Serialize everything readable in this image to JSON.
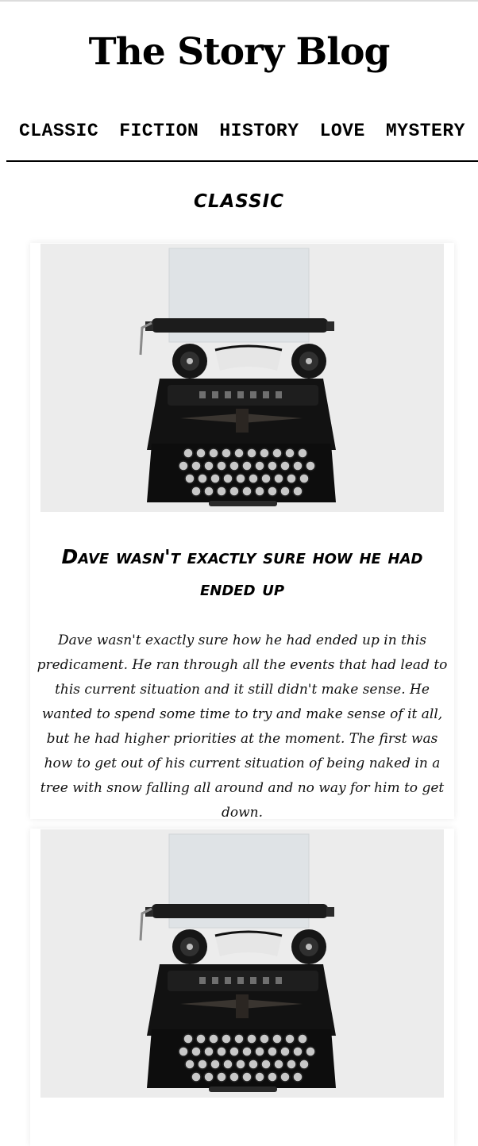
{
  "site": {
    "title": "The Story Blog"
  },
  "nav": {
    "items": [
      {
        "label": "CLASSIC"
      },
      {
        "label": "FICTION"
      },
      {
        "label": "HISTORY"
      },
      {
        "label": "LOVE"
      },
      {
        "label": "MYSTERY"
      }
    ]
  },
  "section": {
    "title": "CLASSIC"
  },
  "posts": [
    {
      "image_icon": "typewriter-photo",
      "title": "Dave wasn't exactly sure how he had ended up",
      "body": "Dave wasn't exactly sure how he had ended up in this predicament. He ran through all the events that had lead to this current situation and it still didn't make sense. He wanted to spend some time to try and make sense of it all, but he had higher priorities at the moment. The first was how to get out of his current situation of being naked in a tree with snow falling all around and no way for him to get down."
    },
    {
      "image_icon": "typewriter-photo"
    }
  ],
  "colors": {
    "text": "#000000",
    "rule": "#000000",
    "card_bg": "#ffffff",
    "image_bg": "#ececec"
  }
}
